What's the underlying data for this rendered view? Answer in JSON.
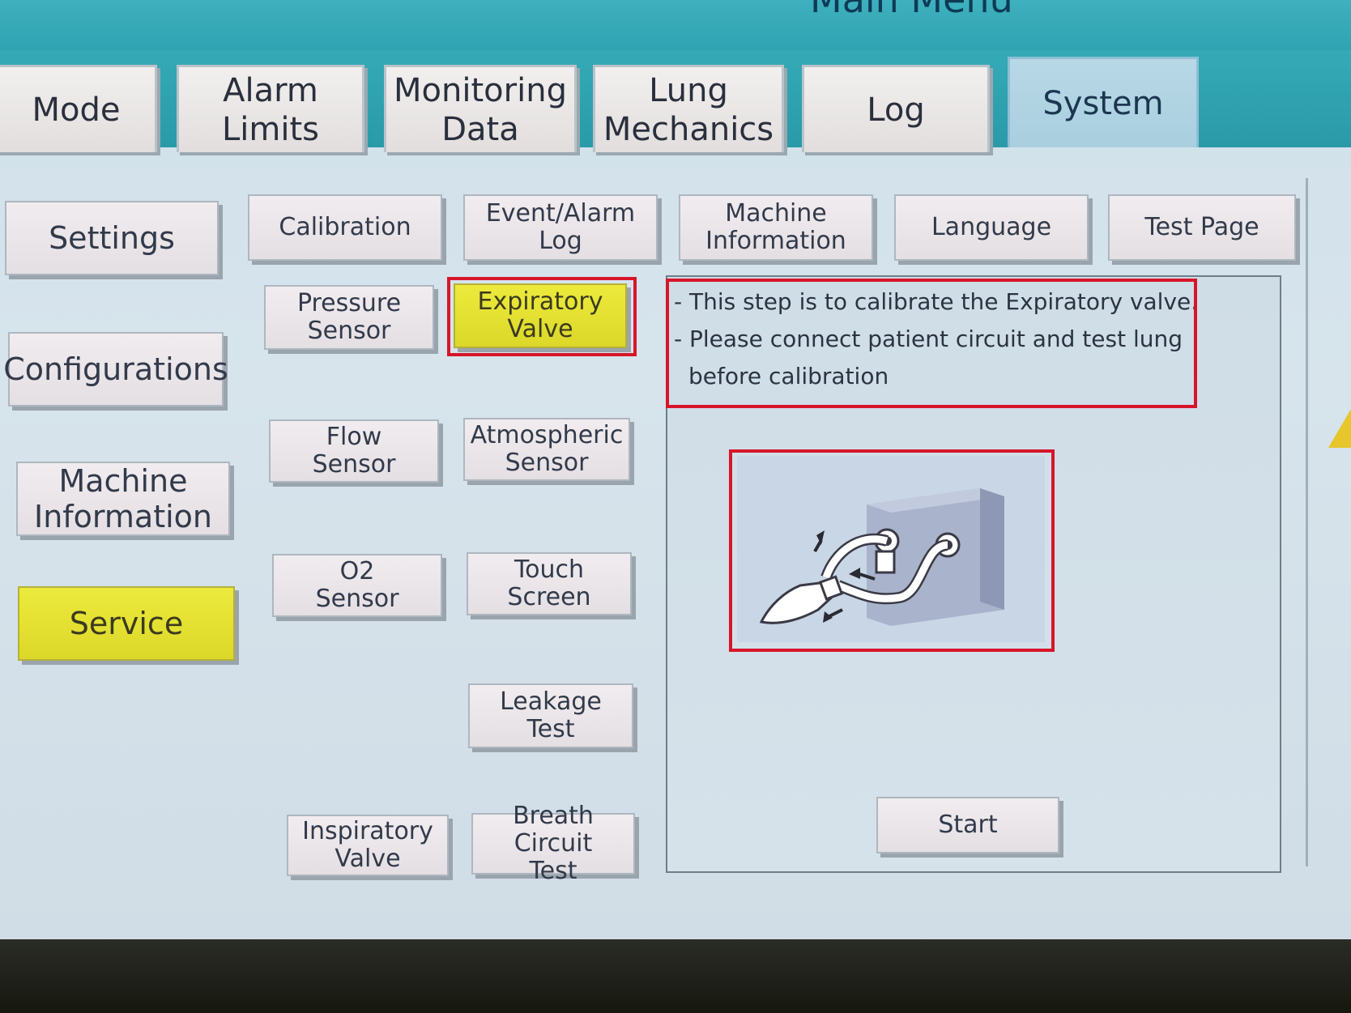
{
  "header": {
    "title": "Main Menu"
  },
  "tabs": [
    {
      "label": "Mode",
      "active": false
    },
    {
      "label": "Alarm\nLimits",
      "active": false
    },
    {
      "label": "Monitoring\nData",
      "active": false
    },
    {
      "label": "Lung\nMechanics",
      "active": false
    },
    {
      "label": "Log",
      "active": false
    },
    {
      "label": "System",
      "active": true
    }
  ],
  "subtabs": [
    {
      "label": "Calibration"
    },
    {
      "label": "Event/Alarm\nLog"
    },
    {
      "label": "Machine\nInformation"
    },
    {
      "label": "Language"
    },
    {
      "label": "Test Page"
    }
  ],
  "sidebar": {
    "items": [
      {
        "label": "Settings",
        "selected": false
      },
      {
        "label": "Configurations",
        "selected": false
      },
      {
        "label": "Machine\nInformation",
        "selected": false
      },
      {
        "label": "Service",
        "selected": true
      }
    ]
  },
  "calibration_buttons": [
    {
      "label": "Pressure\nSensor",
      "selected": false
    },
    {
      "label": "Expiratory\nValve",
      "selected": true
    },
    {
      "label": "Flow\nSensor",
      "selected": false
    },
    {
      "label": "Atmospheric\nSensor",
      "selected": false
    },
    {
      "label": "O2\nSensor",
      "selected": false
    },
    {
      "label": "Touch\nScreen",
      "selected": false
    },
    {
      "label": "Leakage\nTest",
      "selected": false
    },
    {
      "label": "Inspiratory\nValve",
      "selected": false
    },
    {
      "label": "Breath Circuit\nTest",
      "selected": false
    }
  ],
  "instructions": {
    "line1": "- This step is to calibrate the Expiratory valve.",
    "line2": "- Please connect patient circuit and test lung",
    "line3": "  before calibration"
  },
  "start_button": {
    "label": "Start"
  },
  "colors": {
    "selected_yellow": "#e6e236",
    "highlight_red": "#d7152a",
    "tab_band_teal": "#2fa3b2"
  },
  "icons": {
    "diagram": "patient-circuit-test-lung-diagram",
    "warning": "warning-triangle-icon"
  }
}
